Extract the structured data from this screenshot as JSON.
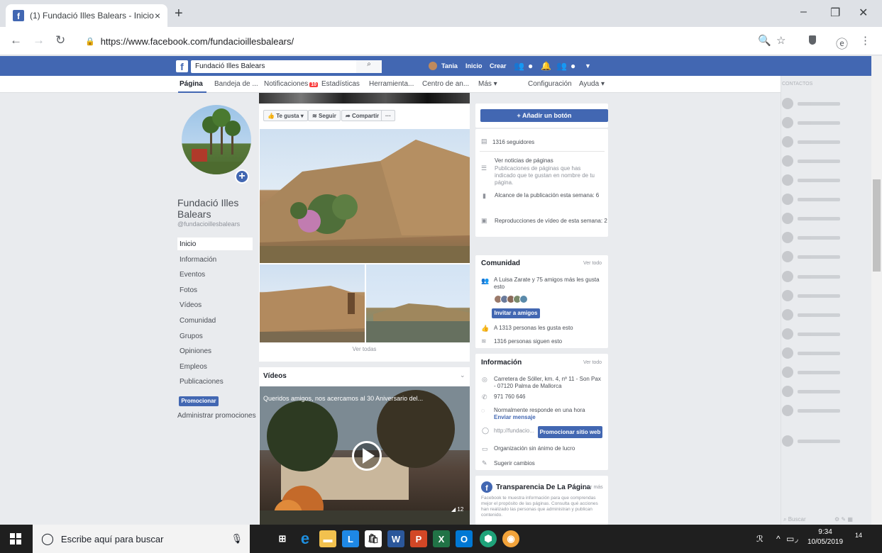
{
  "browser": {
    "tab_title": "(1) Fundació Illes Balears - Inicio",
    "tab_close": "×",
    "new_tab": "+",
    "url": "https://www.facebook.com/fundacioillesbalears/",
    "win_min": "–",
    "win_max": "❐",
    "win_close": "✕"
  },
  "fb_header": {
    "search_value": "Fundació Illes Balears",
    "user": "Tania",
    "home": "Inicio",
    "create": "Crear"
  },
  "page_tabs": [
    "Página",
    "Bandeja de ...",
    "Notificaciones",
    "Estadísticas",
    "Herramienta...",
    "Centro de an...",
    "Más ▾",
    "Configuración",
    "Ayuda ▾"
  ],
  "notif_count": "10",
  "page": {
    "name": "Fundació Illes Balears",
    "handle": "@fundacioillesbalears",
    "nav": [
      "Inicio",
      "Información",
      "Eventos",
      "Fotos",
      "Vídeos",
      "Comunidad",
      "Grupos",
      "Opiniones",
      "Empleos",
      "Publicaciones"
    ],
    "promote": "Promocionar",
    "admin_promos": "Administrar promociones"
  },
  "actions": {
    "like": "Te gusta ▾",
    "follow": "Seguir",
    "share": "Compartir",
    "more": "···",
    "add_button": "+ Añadir un botón"
  },
  "photos": {
    "see_all": "Ver todas"
  },
  "videos": {
    "title": "Vídeos",
    "caption": "Queridos amigos, nos acercamos al 30 Aniversario del...",
    "views": "12"
  },
  "stats": {
    "followers": "1316 seguidores",
    "news_title": "Ver noticias de páginas",
    "news_desc": "Publicaciones de páginas que has indicado que te gustan en nombre de tu página.",
    "reach": "Alcance de la publicación esta semana: 6",
    "video_views": "Reproducciones de vídeo de esta semana: 2"
  },
  "community": {
    "title": "Comunidad",
    "see_all": "Ver todo",
    "friends_text": "A Luisa Zarate y 75 amigos más les gusta esto",
    "invite": "Invitar a amigos",
    "likes": "A 1313 personas les gusta esto",
    "follows": "1316 personas siguen esto"
  },
  "info": {
    "title": "Información",
    "see_all": "Ver todo",
    "address": "Carretera de Sóller, km. 4, nº 11 - Son Pax - 07120 Palma de Mallorca",
    "phone": "971 760 646",
    "responds": "Normalmente responde en una hora",
    "send_msg": "Enviar mensaje",
    "website": "http://fundacio...",
    "promote_site": "Promocionar sitio web",
    "category": "Organización sin ánimo de lucro",
    "suggest": "Sugerir cambios"
  },
  "transparency": {
    "title": "Transparencia De La Página",
    "see_more": "Ver más",
    "desc": "Facebook te muestra información para que comprendas mejor el propósito de las páginas. Consulta qué acciones han realizado las personas que administran y publican contenido."
  },
  "chat": {
    "contacts_header": "CONTACTOS",
    "search": "Buscar"
  },
  "taskbar": {
    "search_placeholder": "Escribe aquí para buscar",
    "time": "9:34",
    "date": "10/05/2019",
    "notifications": "14"
  }
}
